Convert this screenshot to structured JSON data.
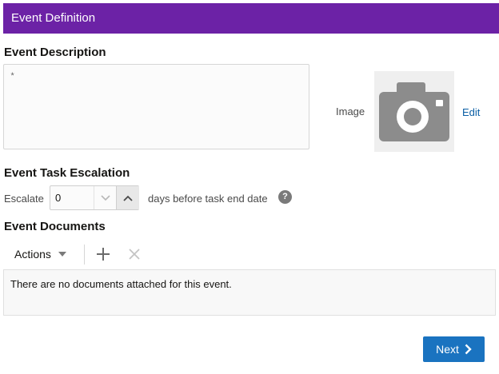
{
  "header": {
    "title": "Event Definition"
  },
  "description": {
    "title": "Event Description",
    "required_marker": "*",
    "value": ""
  },
  "image": {
    "label": "Image",
    "icon": "camera-icon",
    "edit_label": "Edit"
  },
  "escalation": {
    "title": "Event Task Escalation",
    "escalate_label": "Escalate",
    "days_value": "0",
    "suffix_label": "days before task end date",
    "help_glyph": "?"
  },
  "documents": {
    "title": "Event Documents",
    "actions_label": "Actions",
    "empty_message": "There are no documents attached for this event."
  },
  "footer": {
    "next_label": "Next"
  },
  "colors": {
    "header_bg": "#6c22a6",
    "link": "#0b5fa5",
    "primary_button": "#1a73c0"
  }
}
